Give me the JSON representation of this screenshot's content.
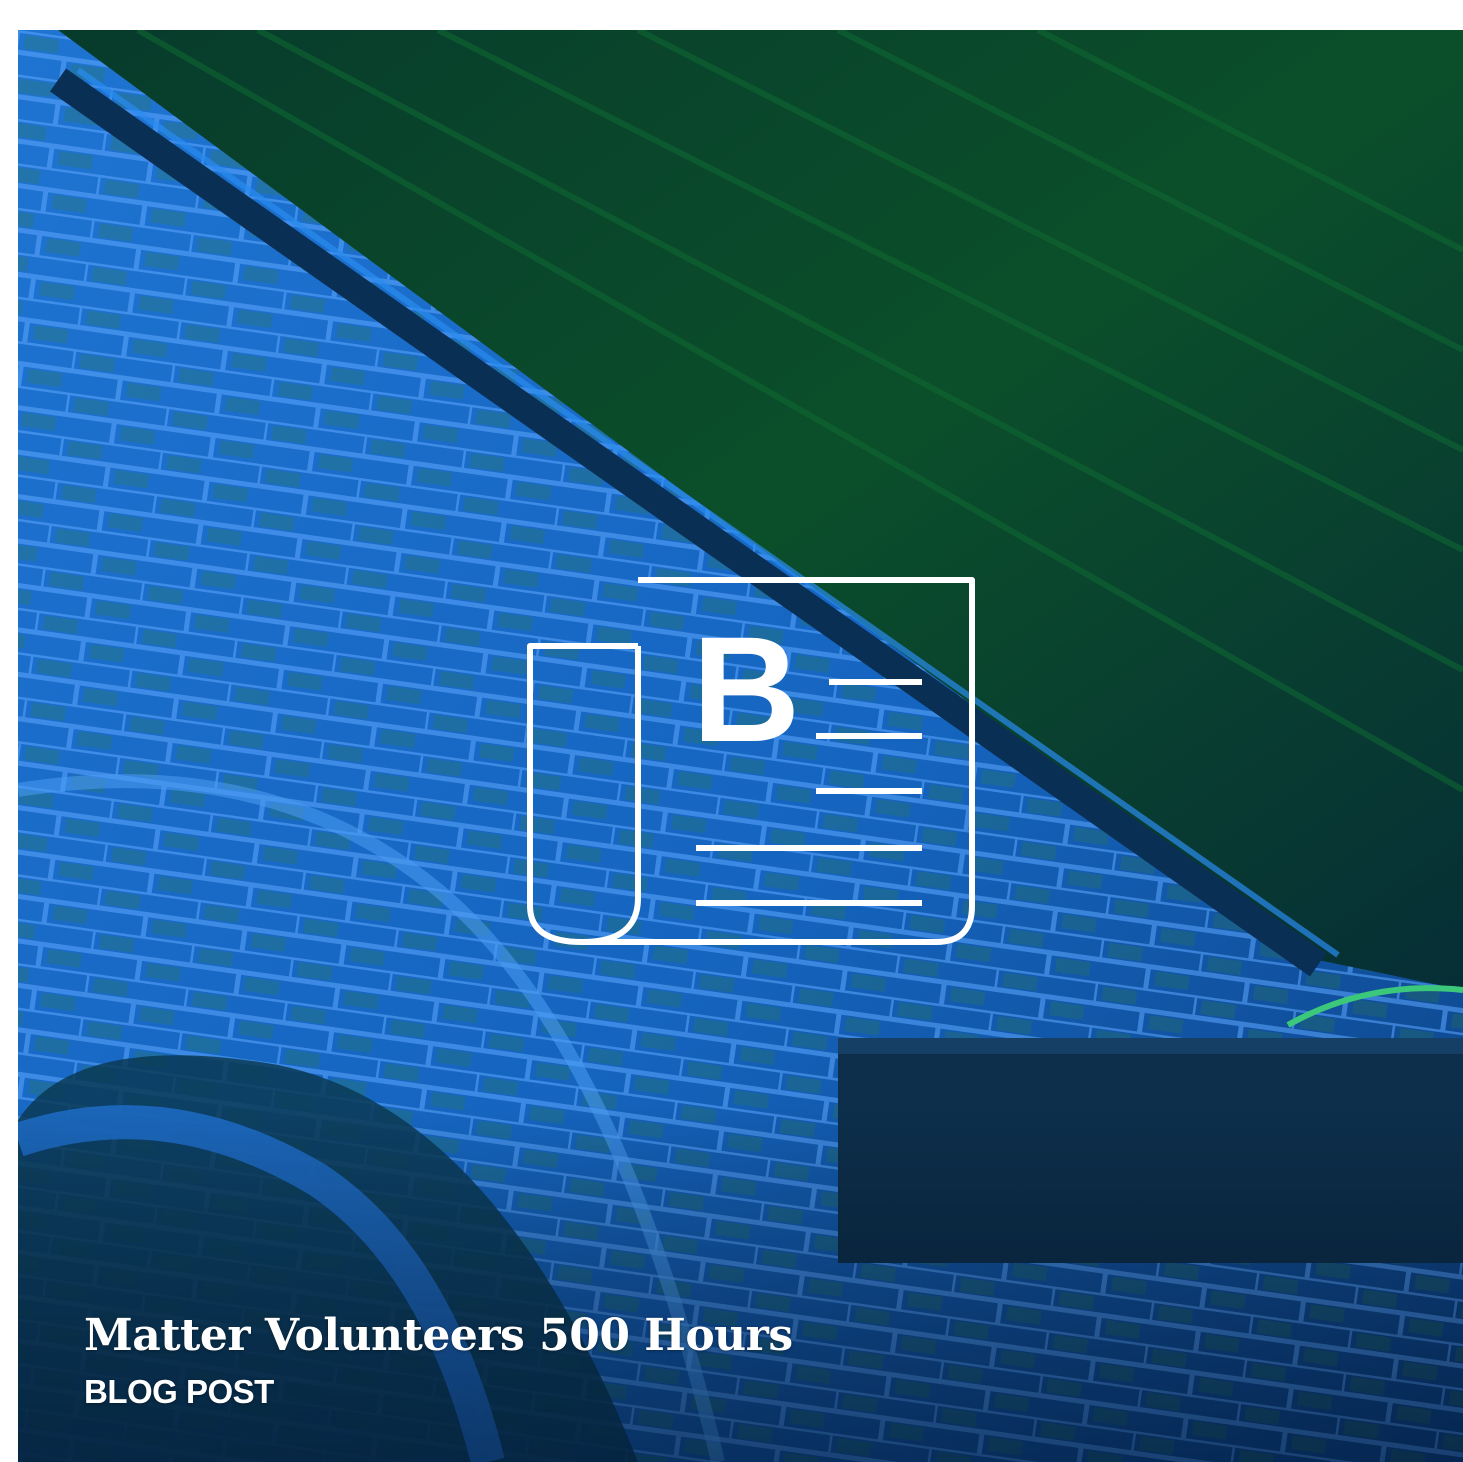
{
  "card": {
    "title": "Matter Volunteers 500 Hours",
    "type_label": "BLOG POST",
    "icon": "blog-post-icon",
    "icon_letter": "B"
  },
  "colors": {
    "overlay_blue": "#1565c0",
    "overlay_green": "#0a4a24",
    "brick_highlight": "#3b8ee6",
    "text": "#ffffff"
  }
}
